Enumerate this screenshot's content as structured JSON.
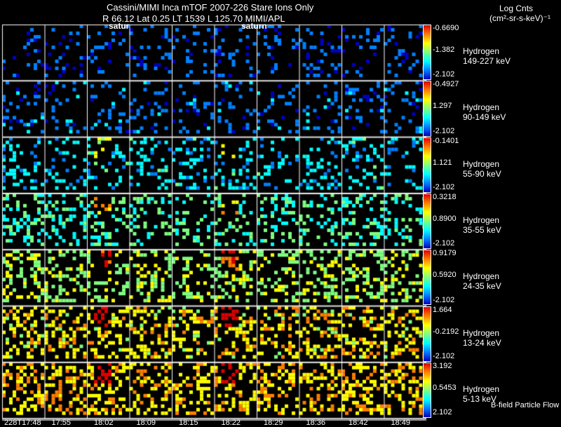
{
  "header": {
    "title": "Cassini/MIMI Inca mTOF  2007-226   Stare   Ions Only",
    "orbit_line": "R        66.12 Lat 0.25 LT 1539 L          125.70  MIMI/APL",
    "saturn_labels": [
      "satur",
      "saturn"
    ],
    "units_line1": "Log Cnts",
    "units_line2": "(cm²-sr-s-keV)⁻¹"
  },
  "footer_label": "B-field Particle Flow",
  "chart_data": {
    "type": "heatmap",
    "title": "Cassini/MIMI Inca mTOF  2007-226   Stare   Ions Only",
    "x_tick_labels": [
      "228T17:48",
      "17:55",
      "18:02",
      "18:09",
      "18:15",
      "18:22",
      "18:29",
      "18:36",
      "18:42",
      "18:49"
    ],
    "rows": [
      {
        "species": "Hydrogen",
        "energy": "149-227 keV",
        "max": "-0.6690",
        "mid": "-1.382",
        "min": "-2.102",
        "level": 0.12
      },
      {
        "species": "Hydrogen",
        "energy": "90-149 keV",
        "max": "-0.4927",
        "mid": "1.297",
        "min": "-2.102",
        "level": 0.15
      },
      {
        "species": "Hydrogen",
        "energy": "55-90 keV",
        "max": "-0.1401",
        "mid": "1.121",
        "min": "-2.102",
        "level": 0.3
      },
      {
        "species": "Hydrogen",
        "energy": "35-55 keV",
        "max": "0.3218",
        "mid": "0.8900",
        "min": "-2.102",
        "level": 0.42
      },
      {
        "species": "Hydrogen",
        "energy": "24-35 keV",
        "max": "0.9179",
        "mid": "0.5920",
        "min": "-2.102",
        "level": 0.55
      },
      {
        "species": "Hydrogen",
        "energy": "13-24 keV",
        "max": "1.664",
        "mid": "-0.2192",
        "min": "-2.102",
        "level": 0.68
      },
      {
        "species": "Hydrogen",
        "energy": "5-13 keV",
        "max": "3.192",
        "mid": "0.5453",
        "min": "2.102",
        "level": 0.72
      }
    ],
    "colorscale": [
      "#0000c0",
      "#0080ff",
      "#00ffff",
      "#80ff80",
      "#ffff00",
      "#ff8000",
      "#e00000"
    ]
  }
}
